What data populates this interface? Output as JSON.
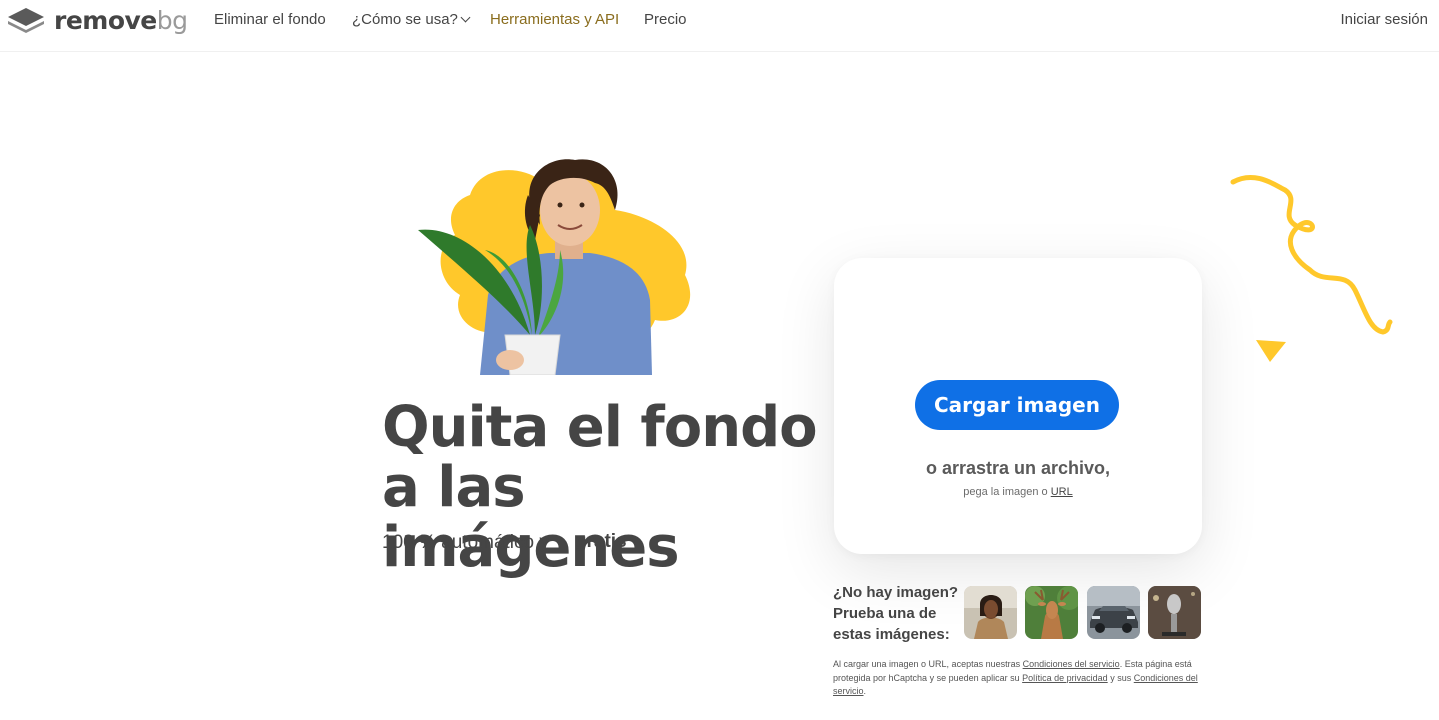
{
  "nav": {
    "logo_main": "remove",
    "logo_accent": "bg",
    "items": [
      {
        "label": "Eliminar el fondo"
      },
      {
        "label": "¿Cómo se usa?"
      },
      {
        "label": "Herramientas y API"
      },
      {
        "label": "Precio"
      }
    ],
    "login": "Iniciar sesión"
  },
  "hero": {
    "title": "Quita el fondo a las imágenes",
    "subtitle": "100 % automático y",
    "highlight": "gratis"
  },
  "upload": {
    "button": "Cargar imagen",
    "drop": "o arrastra un archivo,",
    "paste_prefix": "pega la imagen o",
    "url_link": "URL"
  },
  "samples": {
    "prompt": "¿No hay imagen? Prueba una de estas imágenes:",
    "items": [
      "woman-photo",
      "deer-photo",
      "car-photo",
      "microphone-photo"
    ]
  },
  "legal": {
    "part1": "Al cargar una imagen o URL, aceptas nuestras",
    "terms1": "Condiciones del servicio",
    "part2": ". Esta página está protegida por hCaptcha y se pueden aplicar su",
    "privacy": "Política de privacidad",
    "part3": "y sus",
    "terms2": "Condiciones del servicio",
    "part4": "."
  },
  "colors": {
    "primary_button": "#0f70e6",
    "accent_yellow": "#ffc82b",
    "text": "#454545",
    "active_nav": "#8a6d1e"
  }
}
